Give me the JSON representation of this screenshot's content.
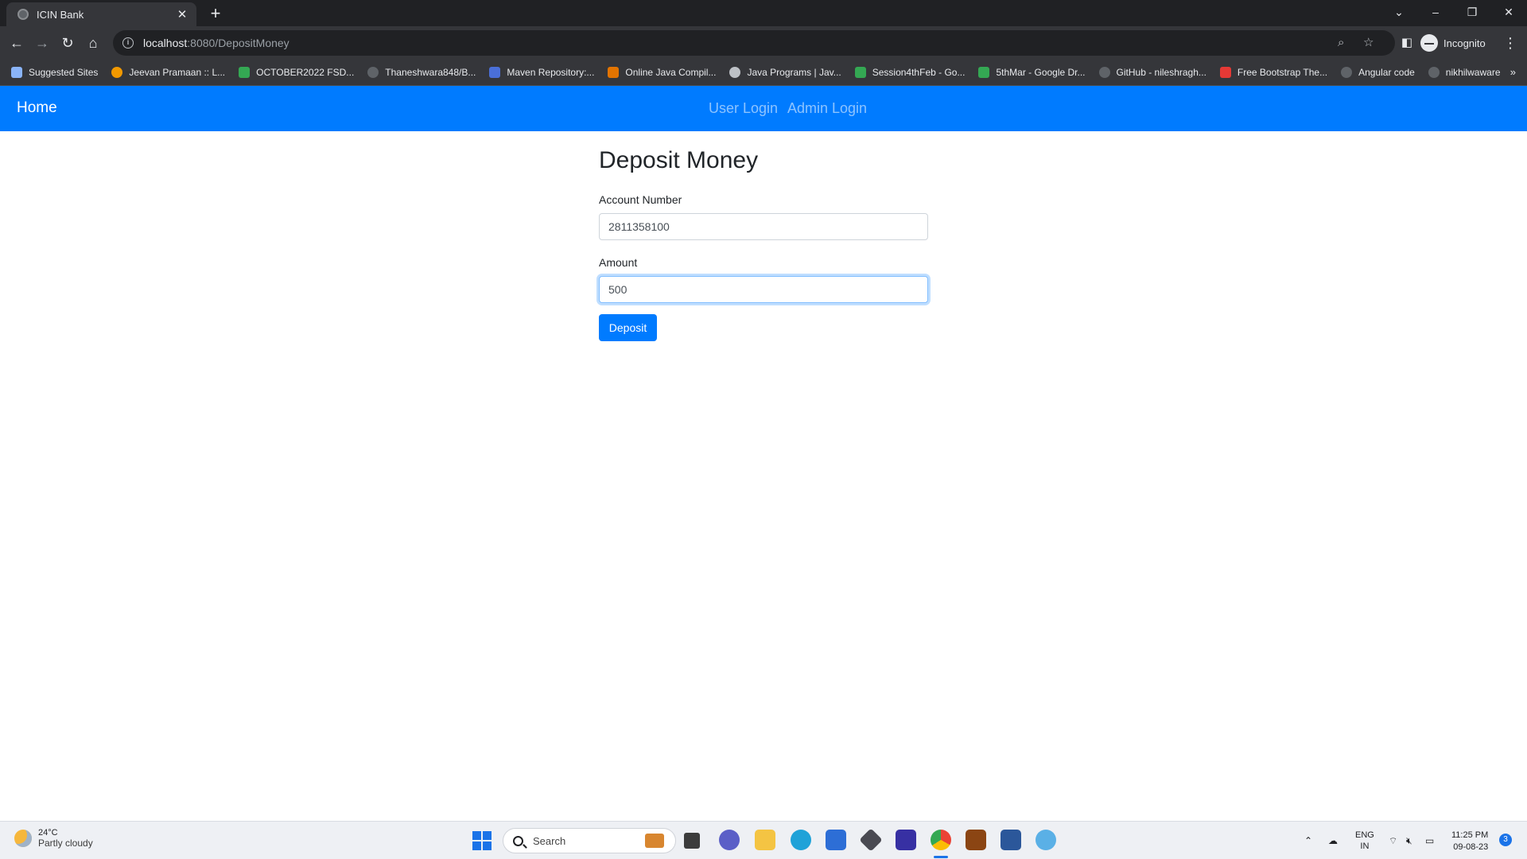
{
  "browser": {
    "tab_title": "ICIN Bank",
    "tab_close": "✕",
    "new_tab": "+",
    "url_host": "localhost",
    "url_path": ":8080/DepositMoney",
    "profile_label": "Incognito",
    "bookmarks": [
      {
        "label": "Suggested Sites",
        "icon": "search-icon",
        "color": "#8ab4f8"
      },
      {
        "label": "Jeevan Pramaan :: L...",
        "icon": "jeevan-icon",
        "color": "#f29900"
      },
      {
        "label": "OCTOBER2022 FSD...",
        "icon": "google-drive-icon",
        "color": "#34a853"
      },
      {
        "label": "Thaneshwara848/B...",
        "icon": "github-icon",
        "color": "#5f6368"
      },
      {
        "label": "Maven Repository:...",
        "icon": "maven-icon",
        "color": "#4a6fd8"
      },
      {
        "label": "Online Java Compil...",
        "icon": "compiler-icon",
        "color": "#e37400"
      },
      {
        "label": "Java Programs | Jav...",
        "icon": "globe-icon",
        "color": "#bdc1c6"
      },
      {
        "label": "Session4thFeb - Go...",
        "icon": "google-drive-icon",
        "color": "#34a853"
      },
      {
        "label": "5thMar - Google Dr...",
        "icon": "google-drive-icon",
        "color": "#34a853"
      },
      {
        "label": "GitHub - nileshragh...",
        "icon": "github-icon",
        "color": "#5f6368"
      },
      {
        "label": "Free Bootstrap The...",
        "icon": "bootstrap-s-icon",
        "color": "#e53935"
      },
      {
        "label": "Angular code",
        "icon": "github-icon",
        "color": "#5f6368"
      },
      {
        "label": "nikhilwaware",
        "icon": "github-icon",
        "color": "#5f6368"
      }
    ],
    "bookmarks_more": "»"
  },
  "app": {
    "brand": "Home",
    "nav": [
      {
        "label": "User Login"
      },
      {
        "label": "Admin Login"
      }
    ],
    "primary_color": "#007bff"
  },
  "form": {
    "title": "Deposit Money",
    "account_label": "Account Number",
    "account_value": "2811358100",
    "amount_label": "Amount",
    "amount_value": "500",
    "submit_label": "Deposit"
  },
  "taskbar": {
    "weather_temp": "24°C",
    "weather_desc": "Partly cloudy",
    "search_placeholder": "Search",
    "lang_line1": "ENG",
    "lang_line2": "IN",
    "time": "11:25 PM",
    "date": "09-08-23",
    "notification_count": "3"
  }
}
